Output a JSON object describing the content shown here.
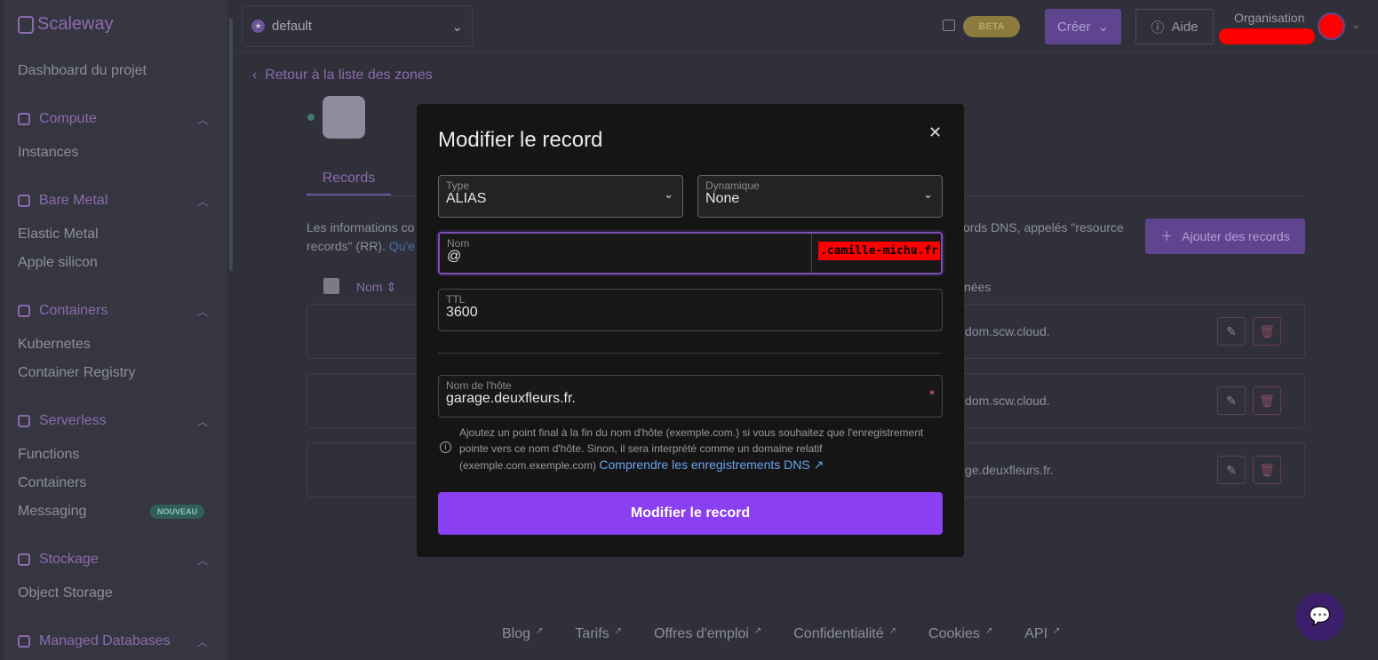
{
  "brand": "Scaleway",
  "sidebar": {
    "dashboard": "Dashboard du projet",
    "groups": [
      {
        "label": "Compute",
        "items": [
          "Instances"
        ]
      },
      {
        "label": "Bare Metal",
        "items": [
          "Elastic Metal",
          "Apple silicon"
        ]
      },
      {
        "label": "Containers",
        "items": [
          "Kubernetes",
          "Container Registry"
        ]
      },
      {
        "label": "Serverless",
        "items": [
          "Functions",
          "Containers",
          "Messaging"
        ]
      },
      {
        "label": "Stockage",
        "items": [
          "Object Storage"
        ]
      },
      {
        "label": "Managed Databases",
        "items": []
      }
    ],
    "messaging_badge": "NOUVEAU"
  },
  "topbar": {
    "project": "default",
    "beta": "BETA",
    "create": "Créer",
    "help": "Aide",
    "organisation": "Organisation"
  },
  "page": {
    "back": "Retour à la liste des zones",
    "tab": "Records",
    "desc_left": "Les informations co",
    "desc_left2": "records\" (RR). ",
    "desc_link": "Qu'e",
    "desc_right": "ords DNS, appelés \"resource",
    "add": "Ajouter des records",
    "col_name": "Nom",
    "col_data": "nées",
    "rows": [
      "dom.scw.cloud.",
      "dom.scw.cloud.",
      "ge.deuxfleurs.fr."
    ]
  },
  "footer": [
    "Blog",
    "Tarifs",
    "Offres d'emploi",
    "Confidentialité",
    "Cookies",
    "API"
  ],
  "modal": {
    "title": "Modifier le record",
    "type_label": "Type",
    "type_value": "ALIAS",
    "dyn_label": "Dynamique",
    "dyn_value": "None",
    "name_label": "Nom",
    "name_value": "@",
    "name_suffix": ".camille-michu.fr",
    "ttl_label": "TTL",
    "ttl_value": "3600",
    "host_label": "Nom de l'hôte",
    "host_value": "garage.deuxfleurs.fr.",
    "help": "Ajoutez un point final à la fin du nom d'hôte (exemple.com.) si vous souhaitez que l'enregistrement pointe vers ce nom d'hôte. Sinon, il sera interprété comme un domaine relatif (exemple.com.exemple.com) ",
    "help_link": "Comprendre les enregistrements DNS",
    "submit": "Modifier le record"
  },
  "colors": {
    "accent": "#8a3ff0",
    "modal_bg": "#151515"
  }
}
